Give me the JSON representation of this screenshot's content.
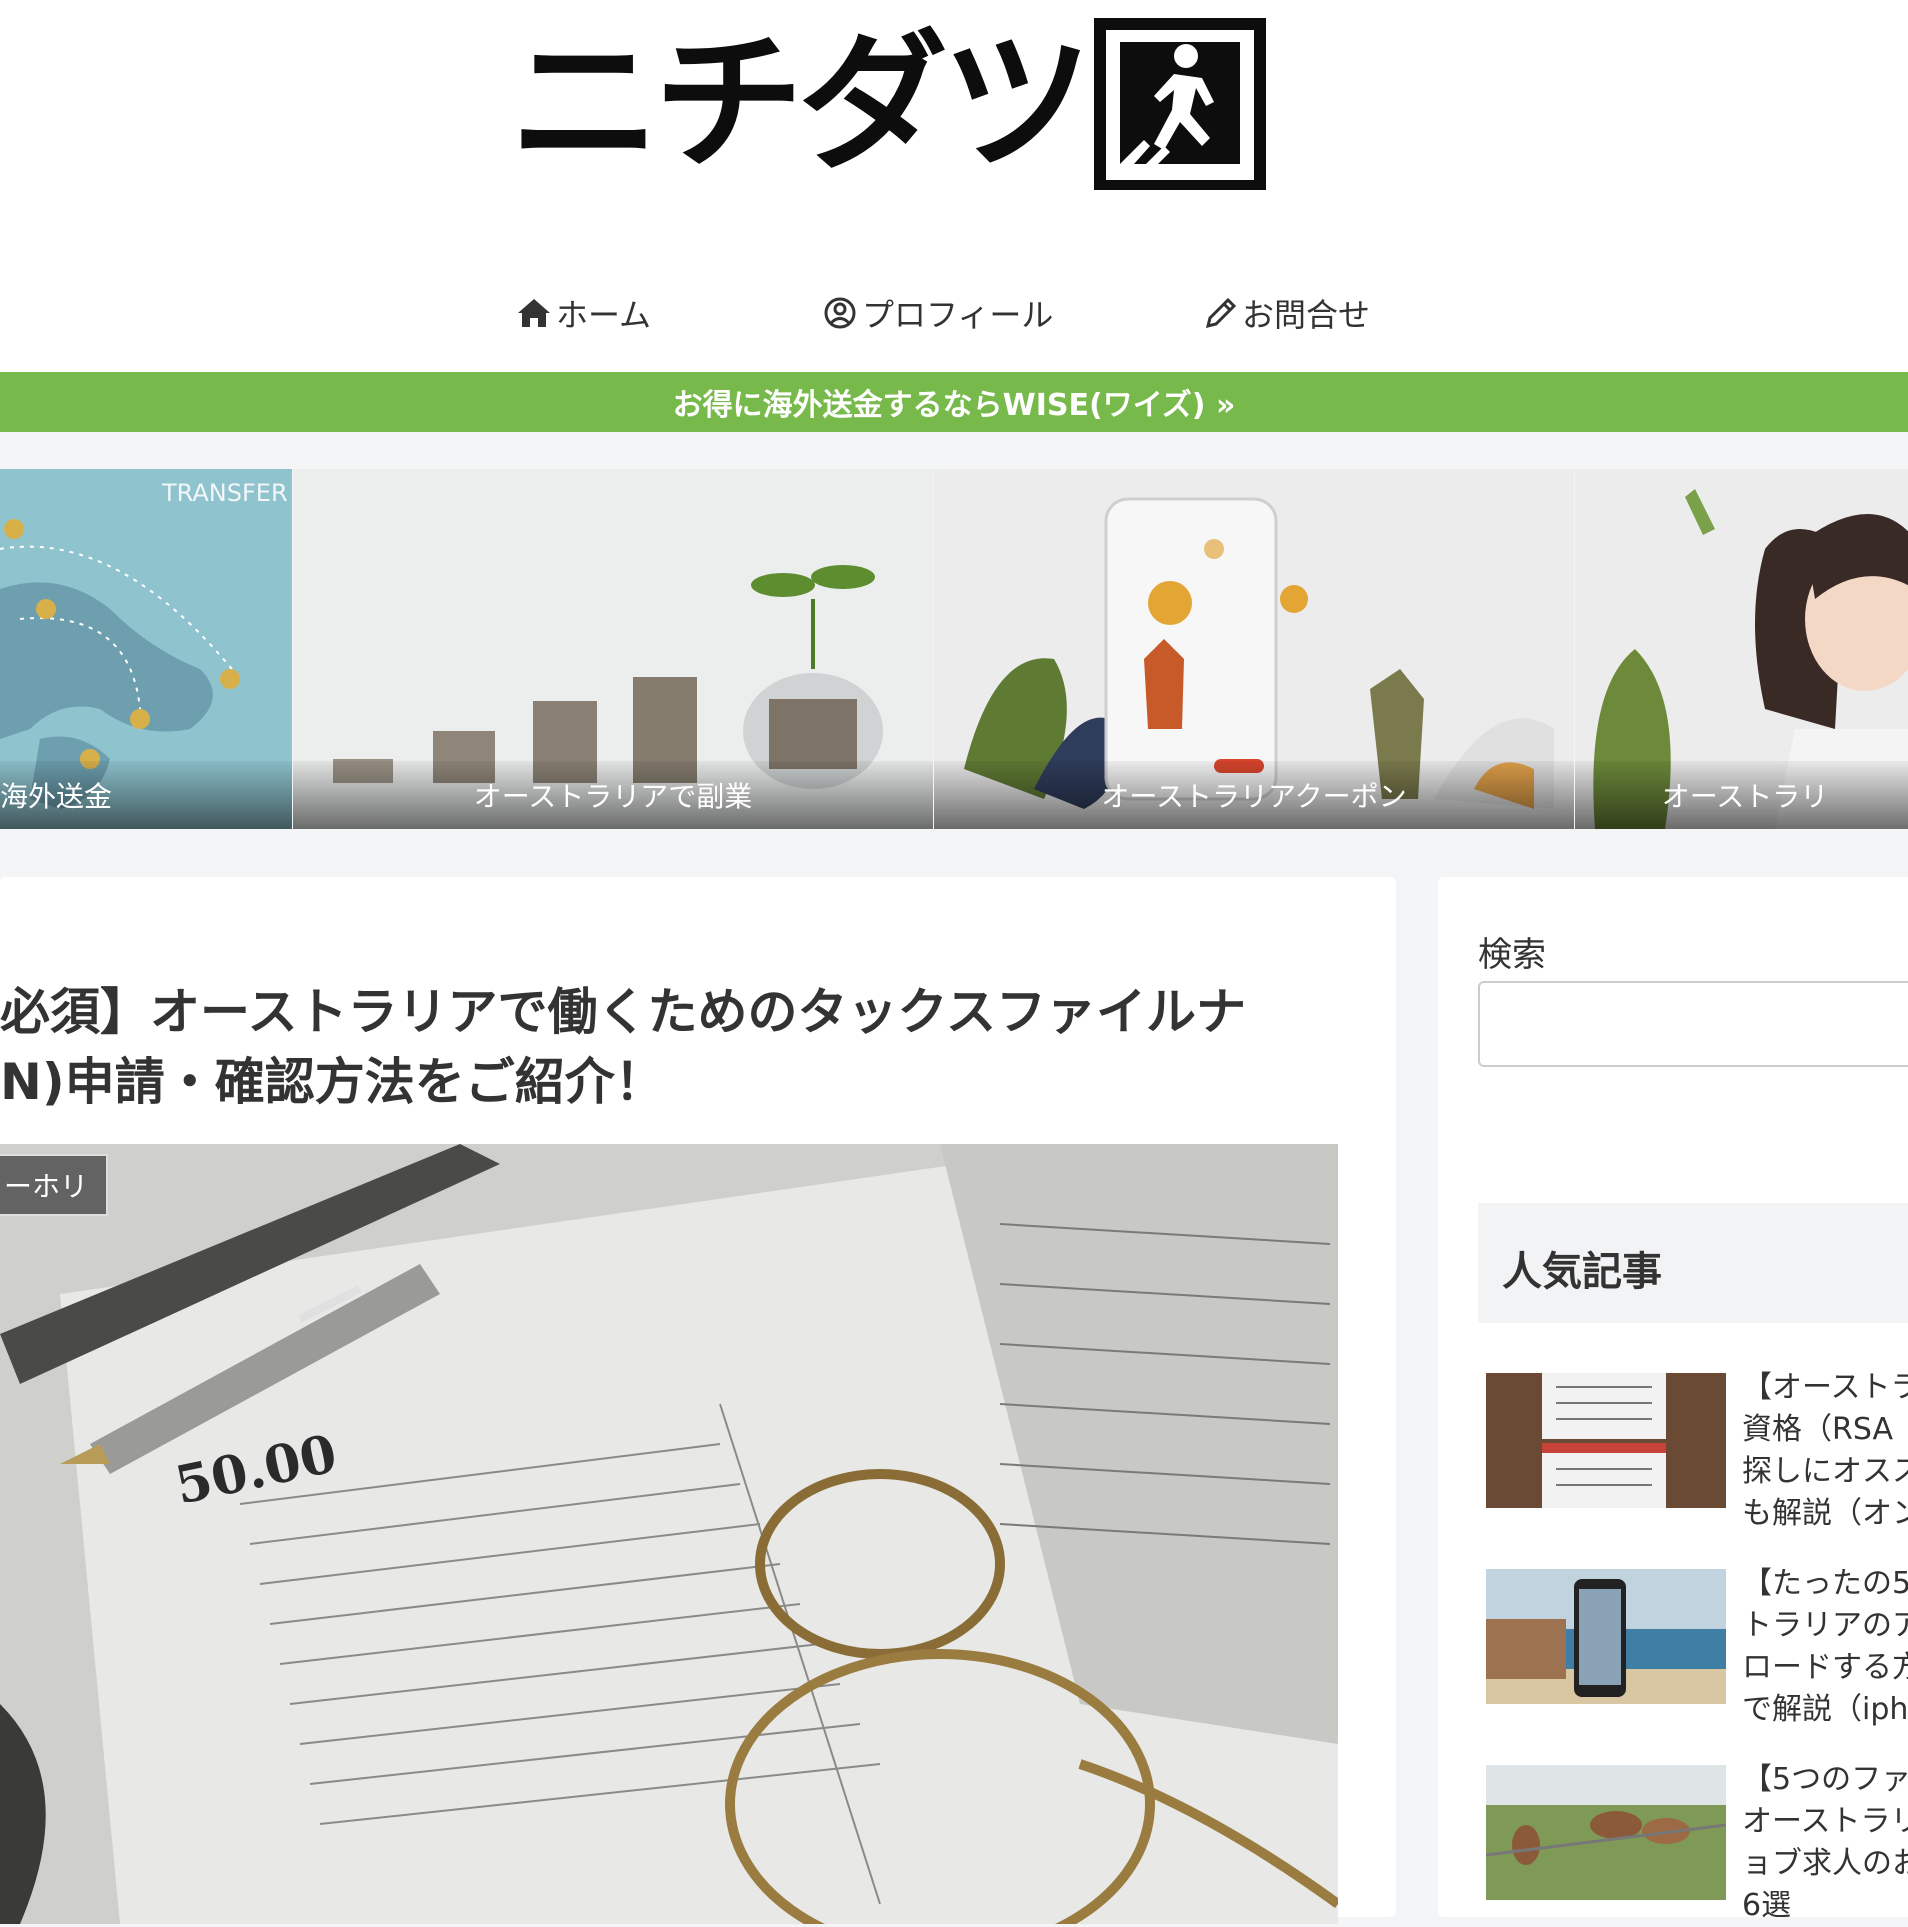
{
  "site": {
    "logo_text": "ニチダツ"
  },
  "nav": {
    "home": "ホーム",
    "profile": "プロフィール",
    "contact": "お問合せ"
  },
  "banner": {
    "text": "お得に海外送金するならWISE(ワイズ) »"
  },
  "carousel": [
    {
      "label": "海外送金",
      "image_text": "TRANSFER"
    },
    {
      "label": "オーストラリアで副業"
    },
    {
      "label": "オーストラリアクーポン"
    },
    {
      "label": "オーストラリ"
    }
  ],
  "article": {
    "title_line1": "必須】オーストラリアで働くためのタックスファイルナ",
    "title_line2": "N)申請・確認方法をご紹介！",
    "category": "ーホリ",
    "image_text": "50.00"
  },
  "sidebar": {
    "search_label": "検索",
    "search_placeholder": "",
    "popular_heading": "人気記事",
    "popular": [
      {
        "title": "【オーストラ\n資格（RSA\n探しにオスス\nも解説（オン"
      },
      {
        "title": "【たったの5\nトラリアのア\nロードする方\nで解説（iph"
      },
      {
        "title": "【5つのファ\nオーストラリ\nョブ求人のお\n6選"
      }
    ]
  },
  "colors": {
    "banner_green": "#78b94c",
    "background": "#f4f5f7"
  }
}
